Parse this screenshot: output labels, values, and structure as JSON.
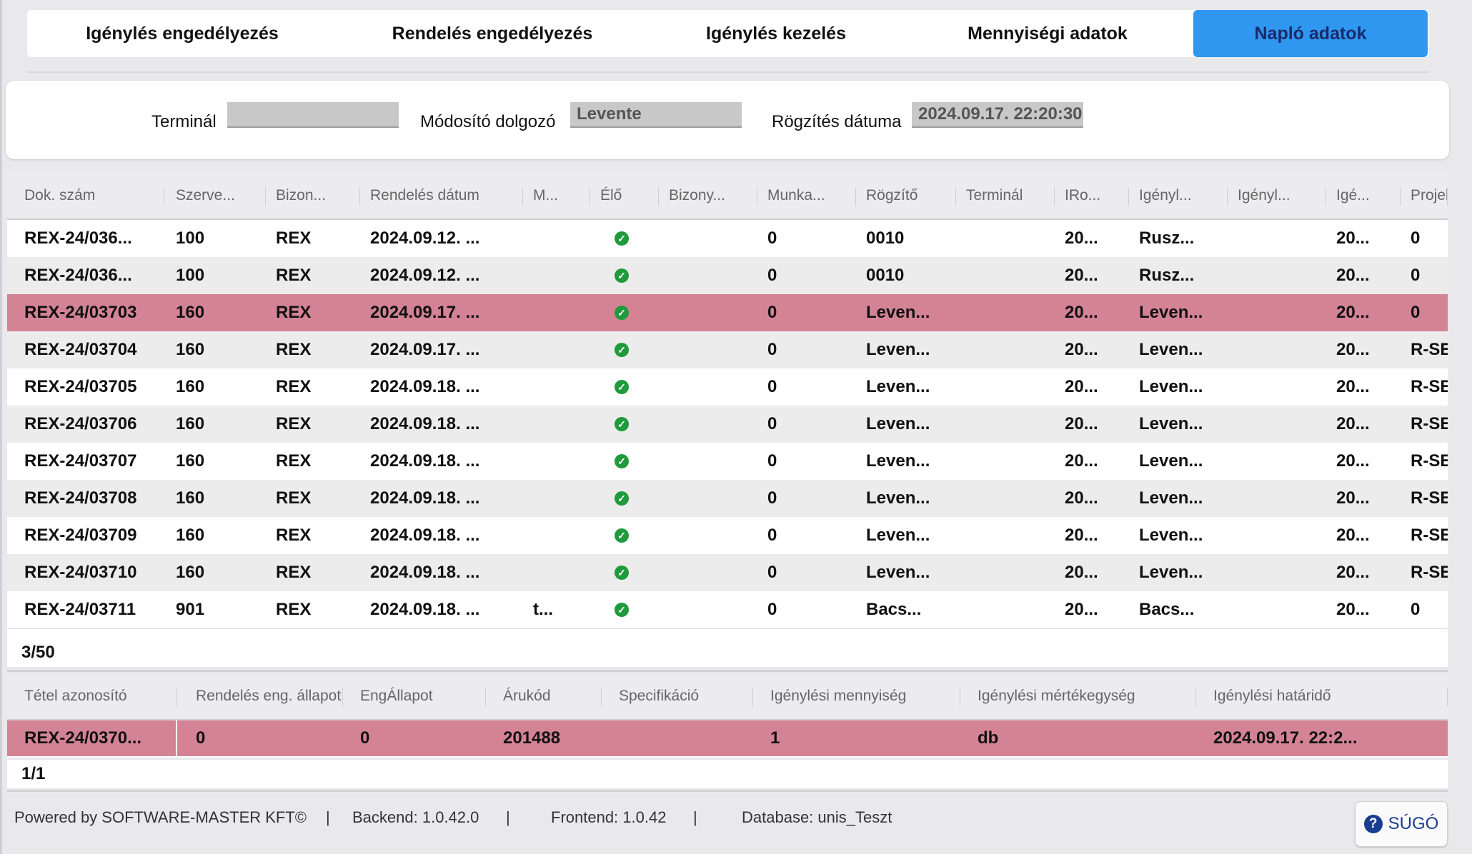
{
  "tabs": [
    {
      "label": "Igénylés engedélyezés",
      "active": false
    },
    {
      "label": "Rendelés engedélyezés",
      "active": false
    },
    {
      "label": "Igénylés kezelés",
      "active": false
    },
    {
      "label": "Mennyiségi adatok",
      "active": false
    },
    {
      "label": "Napló adatok",
      "active": true
    }
  ],
  "filter": {
    "terminal_label": "Terminál",
    "terminal_value": "",
    "modifier_label": "Módosító dolgozó",
    "modifier_value": "Levente",
    "date_label": "Rögzítés dátuma",
    "date_value": "2024.09.17. 22:20:30"
  },
  "main_grid": {
    "columns": [
      "Dok. szám",
      "Szerve...",
      "Bizon...",
      "Rendelés dátum",
      "M...",
      "Élő",
      "Bizony...",
      "Munka...",
      "Rögzítő",
      "Terminál",
      "IRo...",
      "Igényl...",
      "Igényl...",
      "Igé...",
      "Projek"
    ],
    "rows": [
      {
        "cells": [
          "REX-24/036...",
          "100",
          "REX",
          "2024.09.12. ...",
          "",
          "",
          "",
          "0",
          "0010",
          "",
          "20...",
          "Rusz...",
          "",
          "20...",
          "0"
        ],
        "live": true,
        "selected": false
      },
      {
        "cells": [
          "REX-24/036...",
          "100",
          "REX",
          "2024.09.12. ...",
          "",
          "",
          "",
          "0",
          "0010",
          "",
          "20...",
          "Rusz...",
          "",
          "20...",
          "0"
        ],
        "live": true,
        "selected": false
      },
      {
        "cells": [
          "REX-24/03703",
          "160",
          "REX",
          "2024.09.17. ...",
          "",
          "",
          "",
          "0",
          "Leven...",
          "",
          "20...",
          "Leven...",
          "",
          "20...",
          "0"
        ],
        "live": true,
        "selected": true
      },
      {
        "cells": [
          "REX-24/03704",
          "160",
          "REX",
          "2024.09.17. ...",
          "",
          "",
          "",
          "0",
          "Leven...",
          "",
          "20...",
          "Leven...",
          "",
          "20...",
          "R-SEF"
        ],
        "live": true,
        "selected": false
      },
      {
        "cells": [
          "REX-24/03705",
          "160",
          "REX",
          "2024.09.18. ...",
          "",
          "",
          "",
          "0",
          "Leven...",
          "",
          "20...",
          "Leven...",
          "",
          "20...",
          "R-SEF"
        ],
        "live": true,
        "selected": false
      },
      {
        "cells": [
          "REX-24/03706",
          "160",
          "REX",
          "2024.09.18. ...",
          "",
          "",
          "",
          "0",
          "Leven...",
          "",
          "20...",
          "Leven...",
          "",
          "20...",
          "R-SEF"
        ],
        "live": true,
        "selected": false
      },
      {
        "cells": [
          "REX-24/03707",
          "160",
          "REX",
          "2024.09.18. ...",
          "",
          "",
          "",
          "0",
          "Leven...",
          "",
          "20...",
          "Leven...",
          "",
          "20...",
          "R-SEF"
        ],
        "live": true,
        "selected": false
      },
      {
        "cells": [
          "REX-24/03708",
          "160",
          "REX",
          "2024.09.18. ...",
          "",
          "",
          "",
          "0",
          "Leven...",
          "",
          "20...",
          "Leven...",
          "",
          "20...",
          "R-SEF"
        ],
        "live": true,
        "selected": false
      },
      {
        "cells": [
          "REX-24/03709",
          "160",
          "REX",
          "2024.09.18. ...",
          "",
          "",
          "",
          "0",
          "Leven...",
          "",
          "20...",
          "Leven...",
          "",
          "20...",
          "R-SEF"
        ],
        "live": true,
        "selected": false
      },
      {
        "cells": [
          "REX-24/03710",
          "160",
          "REX",
          "2024.09.18. ...",
          "",
          "",
          "",
          "0",
          "Leven...",
          "",
          "20...",
          "Leven...",
          "",
          "20...",
          "R-SEF"
        ],
        "live": true,
        "selected": false
      },
      {
        "cells": [
          "REX-24/03711",
          "901",
          "REX",
          "2024.09.18. ...",
          "t...",
          "",
          "",
          "0",
          "Bacs...",
          "",
          "20...",
          "Bacs...",
          "",
          "20...",
          "0"
        ],
        "live": true,
        "selected": false
      }
    ],
    "counter": "3/50"
  },
  "detail_grid": {
    "columns": [
      "Tétel azonosító",
      "Rendelés eng. állapot",
      "EngÁllapot",
      "Árukód",
      "Specifikáció",
      "Igénylési mennyiség",
      "Igénylési mértékegység",
      "Igénylési határidő"
    ],
    "rows": [
      {
        "cells": [
          "REX-24/0370...",
          "0",
          "0",
          "201488",
          "",
          "1",
          "db",
          "2024.09.17. 22:2..."
        ],
        "selected": true
      }
    ],
    "counter": "1/1"
  },
  "footer": {
    "powered": "Powered by SOFTWARE-MASTER KFT©",
    "sep": "|",
    "backend": "Backend: 1.0.42.0",
    "frontend": "Frontend: 1.0.42",
    "database": "Database: unis_Teszt",
    "help_label": "SÚGÓ"
  },
  "colors": {
    "active_tab": "#2f97f0",
    "selected_row": "#d48395",
    "live_check": "#1f9a3c",
    "help_accent": "#1a3d8f"
  },
  "icons": {
    "live": "check-circle-icon",
    "help": "question-circle-icon"
  }
}
